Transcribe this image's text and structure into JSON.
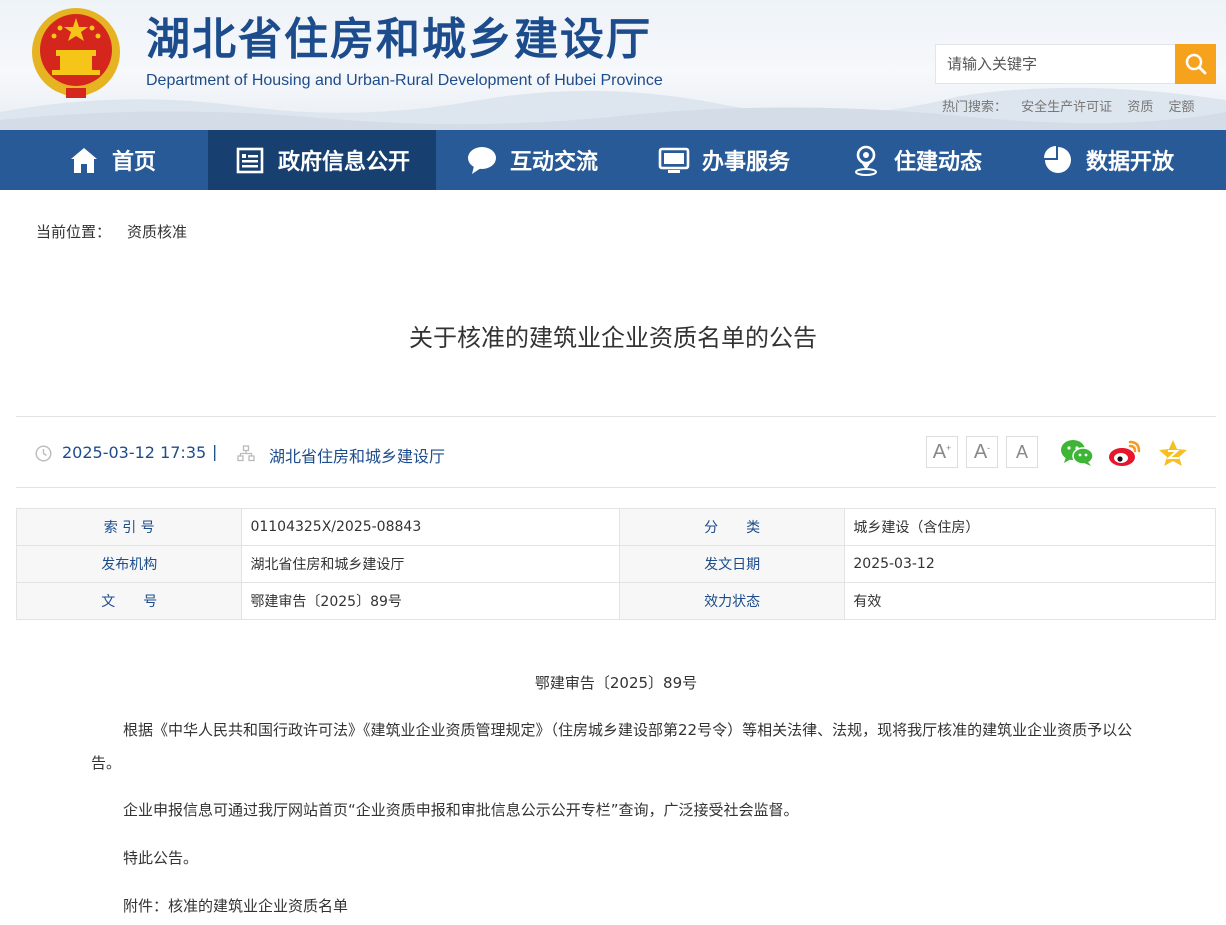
{
  "header": {
    "title": "湖北省住房和城乡建设厅",
    "subtitle": "Department of Housing and Urban-Rural Development of Hubei Province",
    "search_placeholder": "请输入关键字",
    "hot_label": "热门搜索：",
    "hot_keywords": [
      "安全生产许可证",
      "资质",
      "定额"
    ]
  },
  "nav": {
    "items": [
      {
        "label": "首页",
        "icon": "home-icon"
      },
      {
        "label": "政府信息公开",
        "icon": "document-list-icon"
      },
      {
        "label": "互动交流",
        "icon": "chat-bubble-icon"
      },
      {
        "label": "办事服务",
        "icon": "monitor-icon"
      },
      {
        "label": "住建动态",
        "icon": "location-pin-icon"
      },
      {
        "label": "数据开放",
        "icon": "pie-chart-icon"
      }
    ],
    "active_index": 1
  },
  "breadcrumb": {
    "prefix": "当前位置：",
    "current": "资质核准"
  },
  "article": {
    "title": "关于核准的建筑业企业资质名单的公告",
    "datetime": "2025-03-12 17:35",
    "separator": "|",
    "source": "湖北省住房和城乡建设厅",
    "font_buttons": [
      "A",
      "A",
      "A"
    ],
    "share_icons": [
      "wechat-icon",
      "weibo-icon",
      "qzone-icon"
    ]
  },
  "info_table": {
    "rows": [
      {
        "k1": "索 引 号",
        "v1": "01104325X/2025-08843",
        "k2": "分　　类",
        "v2": "城乡建设（含住房）"
      },
      {
        "k1": "发布机构",
        "v1": "湖北省住房和城乡建设厅",
        "k2": "发文日期",
        "v2": "2025-03-12"
      },
      {
        "k1": "文　　号",
        "v1": "鄂建审告〔2025〕89号",
        "k2": "效力状态",
        "v2": "有效"
      }
    ]
  },
  "body": {
    "doc_no": "鄂建审告〔2025〕89号",
    "p1": "根据《中华人民共和国行政许可法》《建筑业企业资质管理规定》（住房城乡建设部第22号令）等相关法律、法规，现将我厅核准的建筑业企业资质予以公告。",
    "p2": "企业申报信息可通过我厅网站首页“企业资质申报和审批信息公示公开专栏”查询，广泛接受社会监督。",
    "p3": "特此公告。",
    "p4": "附件：核准的建筑业企业资质名单"
  },
  "colors": {
    "nav_bg": "#275a96",
    "nav_active": "#173f70",
    "brand_blue": "#1d4c8c",
    "search_btn": "#f7a21d"
  }
}
